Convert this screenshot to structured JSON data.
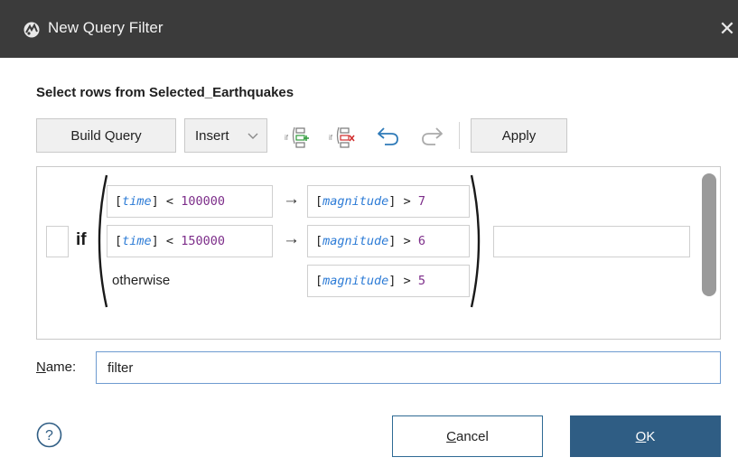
{
  "window": {
    "title": "New Query Filter",
    "close_glyph": "✕"
  },
  "section_title": "Select rows from Selected_Earthquakes",
  "toolbar": {
    "build_query": "Build Query",
    "insert": "Insert",
    "apply": "Apply",
    "icons": [
      "if-add-condition-icon",
      "if-remove-condition-icon",
      "undo-icon",
      "redo-icon"
    ]
  },
  "query": {
    "keyword_if": "if",
    "otherwise": "otherwise",
    "arrow": "→",
    "rows": [
      {
        "condition": {
          "field": "time",
          "op": "<",
          "value": "100000"
        },
        "result": {
          "field": "magnitude",
          "op": ">",
          "value": "7"
        }
      },
      {
        "condition": {
          "field": "time",
          "op": "<",
          "value": "150000"
        },
        "result": {
          "field": "magnitude",
          "op": ">",
          "value": "6"
        }
      },
      {
        "result": {
          "field": "magnitude",
          "op": ">",
          "value": "5"
        }
      }
    ]
  },
  "name": {
    "label_mnemonic": "N",
    "label_rest": "ame:",
    "value": "filter"
  },
  "footer": {
    "help_glyph": "?",
    "cancel_mnemonic": "C",
    "cancel_rest": "ancel",
    "ok_mnemonic": "O",
    "ok_rest": "K"
  },
  "colors": {
    "titlebar": "#3b3b3b",
    "field": "#2c7bd6",
    "number": "#7d2e8a",
    "ok_button": "#2f5d84",
    "name_border": "#6e9bd0"
  }
}
